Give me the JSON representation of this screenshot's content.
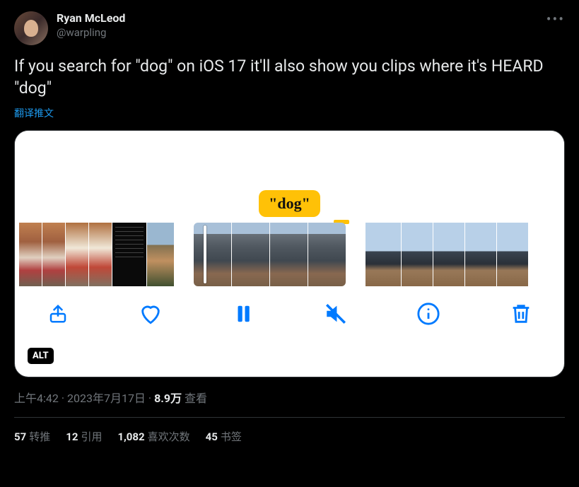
{
  "user": {
    "display_name": "Ryan McLeod",
    "handle": "@warpling"
  },
  "tweet_text": "If you search for \"dog\" on iOS 17 it'll also show you clips where it's HEARD \"dog\"",
  "translate_label": "翻译推文",
  "media": {
    "caption_tag": "\"dog\"",
    "alt_badge": "ALT",
    "toolbar": {
      "share": "share",
      "like": "like",
      "pause": "pause",
      "mute": "mute",
      "info": "info",
      "delete": "delete"
    }
  },
  "meta": {
    "time": "上午4:42",
    "separator": " · ",
    "date": "2023年7月17日",
    "views_count": "8.9万",
    "views_label": " 查看"
  },
  "stats": {
    "retweets": {
      "count": "57",
      "label": "转推"
    },
    "quotes": {
      "count": "12",
      "label": "引用"
    },
    "likes": {
      "count": "1,082",
      "label": "喜欢次数"
    },
    "bookmarks": {
      "count": "45",
      "label": "书签"
    }
  }
}
